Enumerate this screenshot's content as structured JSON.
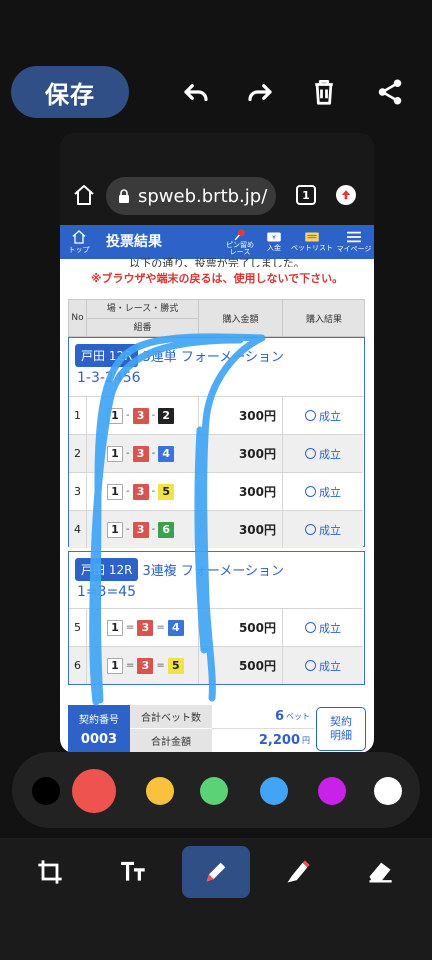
{
  "editor": {
    "save_label": "保存",
    "colors": [
      "#000000",
      "#ef5350",
      "#f9c13c",
      "#5bd275",
      "#41a4f4",
      "#c821e8",
      "#ffffff"
    ],
    "selected_color": "#ef5350",
    "stroke_color": "#41a4f4",
    "tools": [
      "crop-icon",
      "text-icon",
      "pen-icon",
      "highlighter-icon",
      "eraser-icon"
    ],
    "active_tool": "pen-icon"
  },
  "browser": {
    "url": "spweb.brtb.jp/",
    "tab_count": "1"
  },
  "header": {
    "top_label": "トップ",
    "title": "投票結果",
    "pin_label": "ピン留め\nレース",
    "deposit_label": "入金",
    "betlist_label": "ベットリスト",
    "mypage_label": "マイページ"
  },
  "notice_top": "以下の通り、投票が完了しました。",
  "notice_warning": "※ブラウザや端末の戻るは、使用しないで下さい。",
  "table_head": {
    "no": "No",
    "race": "場・レース・勝式",
    "combo": "組番",
    "amount": "購入金額",
    "result": "購入結果"
  },
  "groups": [
    {
      "badge": "戸田 12R",
      "type": "3連単 フォーメーション",
      "combo": "1-3-2456",
      "rows": [
        {
          "no": "1",
          "nums": [
            "1",
            "3",
            "2"
          ],
          "sep": "-",
          "amount": "300円",
          "result": "成立"
        },
        {
          "no": "2",
          "nums": [
            "1",
            "3",
            "4"
          ],
          "sep": "-",
          "amount": "300円",
          "result": "成立"
        },
        {
          "no": "3",
          "nums": [
            "1",
            "3",
            "5"
          ],
          "sep": "-",
          "amount": "300円",
          "result": "成立"
        },
        {
          "no": "4",
          "nums": [
            "1",
            "3",
            "6"
          ],
          "sep": "-",
          "amount": "300円",
          "result": "成立"
        }
      ]
    },
    {
      "badge": "戸田 12R",
      "type": "3連複 フォーメーション",
      "combo": "1=3=45",
      "rows": [
        {
          "no": "5",
          "nums": [
            "1",
            "3",
            "4"
          ],
          "sep": "=",
          "amount": "500円",
          "result": "成立"
        },
        {
          "no": "6",
          "nums": [
            "1",
            "3",
            "5"
          ],
          "sep": "=",
          "amount": "500円",
          "result": "成立"
        }
      ]
    }
  ],
  "summary": {
    "contract_label": "契約番号",
    "contract_no": "0003",
    "bet_count_label": "合計ベット数",
    "bet_count": "6",
    "bet_unit": "ベット",
    "total_label": "合計金額",
    "total": "2,200",
    "total_unit": "円",
    "detail_button": "契約\n明細"
  }
}
